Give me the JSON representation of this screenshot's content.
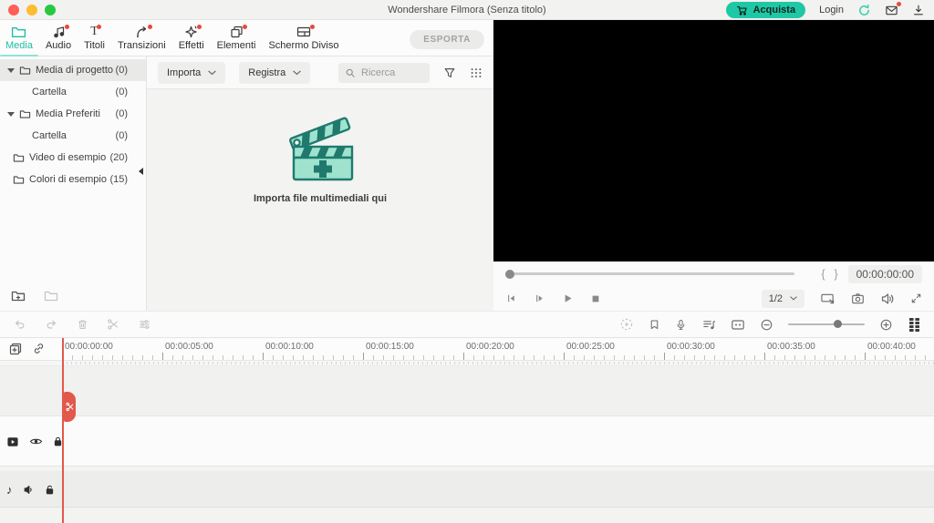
{
  "colors": {
    "accent": "#1ec8a5",
    "notification": "#e8483d",
    "playhead": "#e2584b",
    "traffic_red": "#ff5f57",
    "traffic_yellow": "#febc2e",
    "traffic_green": "#28c840"
  },
  "window": {
    "title": "Wondershare Filmora (Senza titolo)"
  },
  "topbar": {
    "buy": "Acquista",
    "login": "Login"
  },
  "tabbar": {
    "tabs": [
      {
        "label": "Media"
      },
      {
        "label": "Audio"
      },
      {
        "label": "Titoli"
      },
      {
        "label": "Transizioni"
      },
      {
        "label": "Effetti"
      },
      {
        "label": "Elementi"
      },
      {
        "label": "Schermo Diviso"
      }
    ],
    "export": "ESPORTA"
  },
  "sidebar": {
    "items": [
      {
        "label": "Media di progetto",
        "count": "(0)"
      },
      {
        "label": "Cartella",
        "count": "(0)"
      },
      {
        "label": "Media Preferiti",
        "count": "(0)"
      },
      {
        "label": "Cartella",
        "count": "(0)"
      },
      {
        "label": "Video di esempio",
        "count": "(20)"
      },
      {
        "label": "Colori di esempio",
        "count": "(15)"
      }
    ]
  },
  "media_panel": {
    "import": "Importa",
    "record": "Registra",
    "search_placeholder": "Ricerca",
    "empty_message": "Importa file multimediali qui"
  },
  "preview": {
    "timecode": "00:00:00:00",
    "quality": "1/2",
    "mark_in": "{",
    "mark_out": "}"
  },
  "timeline": {
    "ruler_labels": [
      "00:00:00:00",
      "00:00:05:00",
      "00:00:10:00",
      "00:00:15:00",
      "00:00:20:00",
      "00:00:25:00",
      "00:00:30:00",
      "00:00:35:00",
      "00:00:40:00"
    ]
  },
  "icons": {
    "titles_glyph": "T",
    "note_glyph": "♪"
  }
}
